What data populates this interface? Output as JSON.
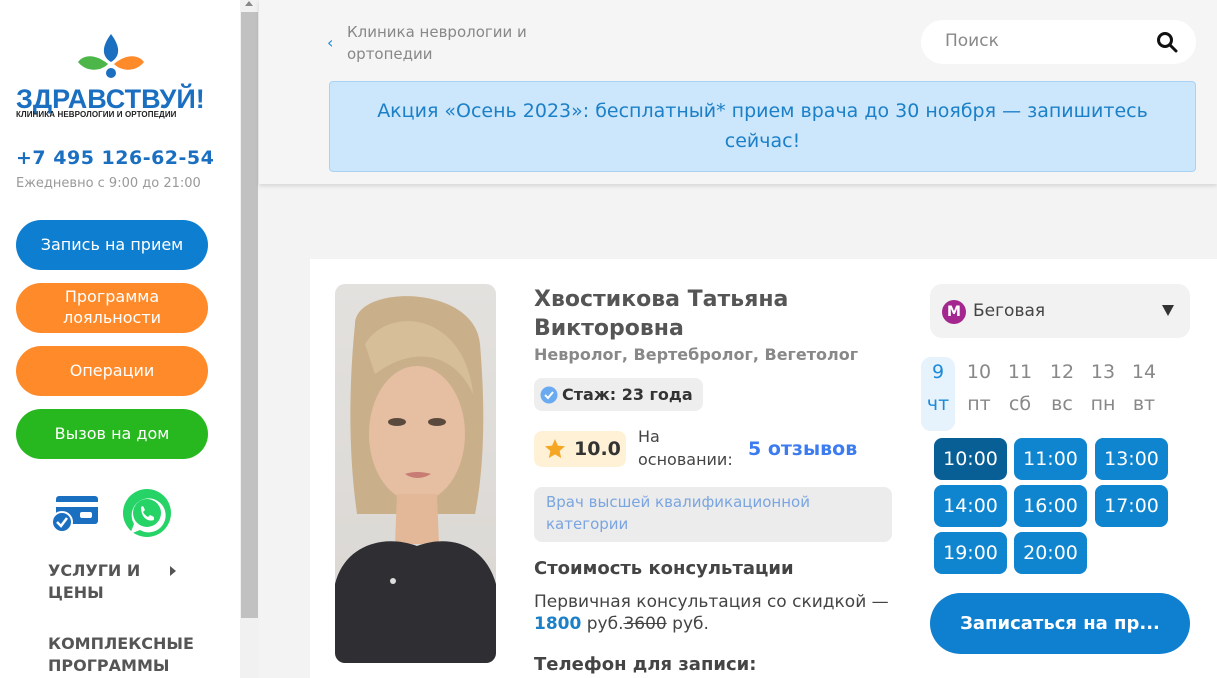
{
  "sidebar": {
    "logo_title": "ЗДРАВСТВУЙ!",
    "logo_subtitle": "КЛИНИКА НЕВРОЛОГИИ И ОРТОПЕДИИ",
    "phone": "+7 495 126-62-54",
    "hours": "Ежедневно с 9:00 до 21:00",
    "buttons": {
      "appointment": "Запись на прием",
      "loyalty": "Программа лояльности",
      "operations": "Операции",
      "home_visit": "Вызов на дом"
    },
    "menu": {
      "services": "УСЛУГИ И ЦЕНЫ",
      "programs": "КОМПЛЕКСНЫЕ ПРОГРАММЫ"
    },
    "colors": {
      "brand_blue": "#1b6fc0",
      "orange": "#ff8a2a",
      "green": "#27b81f"
    }
  },
  "header": {
    "breadcrumb": "Клиника неврологии и ортопедии",
    "search_placeholder": "Поиск",
    "promo": "Акция «Осень 2023»: бесплатный* прием врача до 30 ноября — запишитесь сейчас!"
  },
  "doctor": {
    "name": "Хвостикова Татьяна Викторовна",
    "specialties": "Невролог, Вертебролог, Вегетолог",
    "experience": "Стаж: 23 года",
    "rating": "10.0",
    "rating_based": "На основании:",
    "reviews": "5 отзывов",
    "qualification": "Врач высшей квалификационной категории",
    "price_title": "Стоимость консультации",
    "price_prefix": "Первичная консультация со скидкой — ",
    "price_new": "1800",
    "price_unit1": " руб.",
    "price_old": "3600",
    "price_unit2": " руб.",
    "phone_title": "Телефон для записи:"
  },
  "schedule": {
    "metro": "Беговая",
    "metro_letter": "М",
    "days": [
      {
        "num": "9",
        "dow": "чт"
      },
      {
        "num": "10",
        "dow": "пт"
      },
      {
        "num": "11",
        "dow": "сб"
      },
      {
        "num": "12",
        "dow": "вс"
      },
      {
        "num": "13",
        "dow": "пн"
      },
      {
        "num": "14",
        "dow": "вт"
      }
    ],
    "slots": [
      "10:00",
      "11:00",
      "13:00",
      "14:00",
      "16:00",
      "17:00",
      "19:00",
      "20:00"
    ],
    "book_button": "Записаться на пр..."
  }
}
